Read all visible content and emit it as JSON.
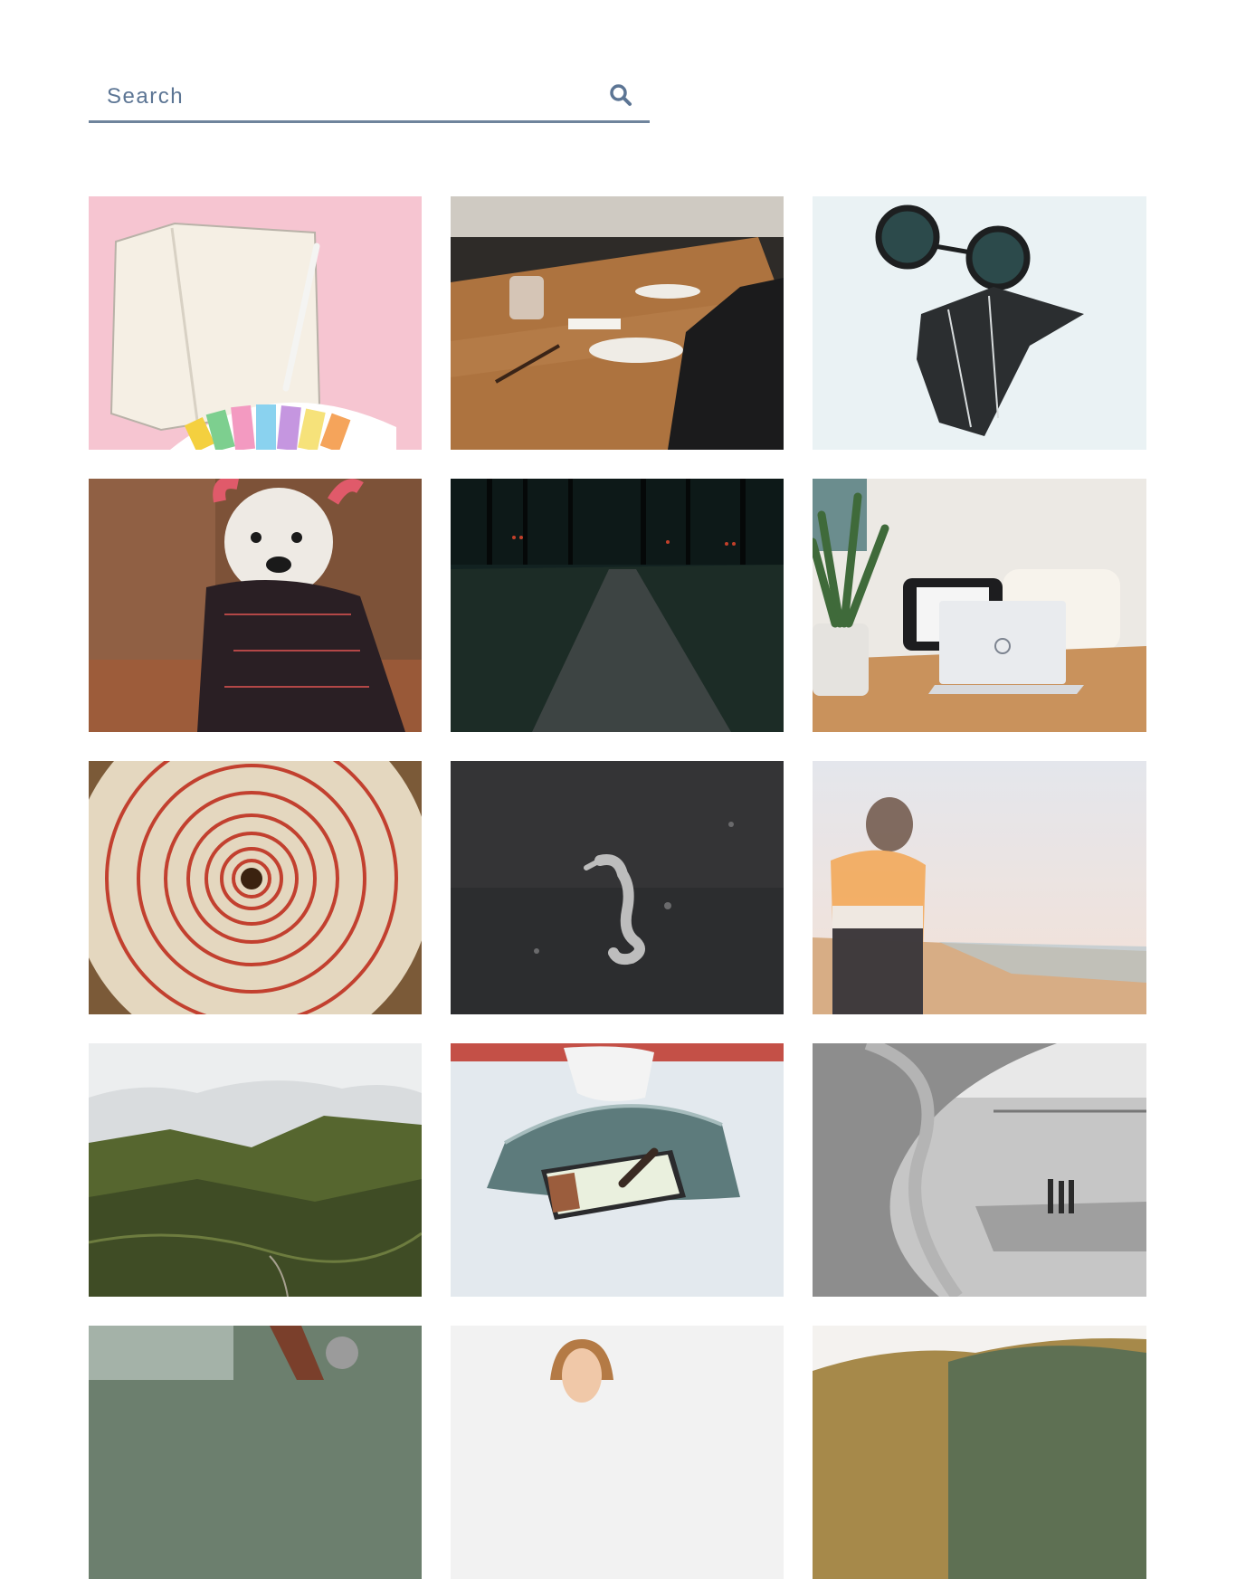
{
  "search": {
    "placeholder": "Search",
    "icon": "search-icon"
  },
  "gallery": {
    "photos": [
      {
        "subject": "notebook-pencil-color-swatches",
        "bg": "#f6c6d2"
      },
      {
        "subject": "wooden-dining-table-plates",
        "bg": "#a9713f"
      },
      {
        "subject": "goggles-and-face-mask",
        "bg": "#e9f1f3"
      },
      {
        "subject": "dog-with-devil-horns",
        "bg": "#8a5a3e"
      },
      {
        "subject": "dark-forest-path",
        "bg": "#1a2422"
      },
      {
        "subject": "laptop-and-plant-on-table",
        "bg": "#ece9e4"
      },
      {
        "subject": "spiral-staircase",
        "bg": "#9a7b57"
      },
      {
        "subject": "seahorse-underwater",
        "bg": "#2f2f31"
      },
      {
        "subject": "blurred-person-on-beach",
        "bg": "#eee4e0"
      },
      {
        "subject": "green-mountain-hills",
        "bg": "#4c5c32"
      },
      {
        "subject": "person-with-tablet-on-bed",
        "bg": "#dfe6ea"
      },
      {
        "subject": "modern-architecture-interior",
        "bg": "#b5b5b5"
      },
      {
        "subject": "koala-in-tree",
        "bg": "#6f8070"
      },
      {
        "subject": "woman-portrait",
        "bg": "#f2f2f2"
      },
      {
        "subject": "autumn-hills",
        "bg": "#a68a48"
      }
    ]
  }
}
